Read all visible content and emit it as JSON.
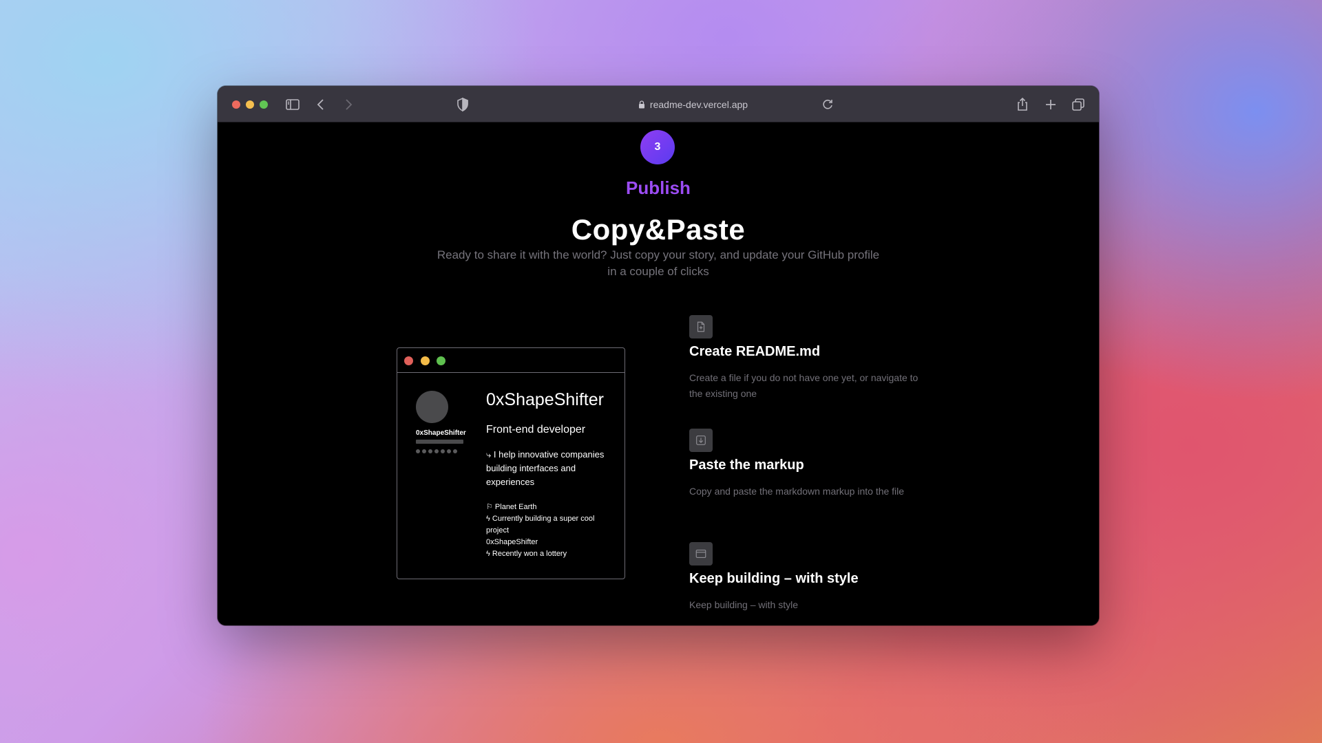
{
  "browser": {
    "url": "readme-dev.vercel.app"
  },
  "hero": {
    "step_number": "3",
    "step_label": "Publish",
    "title": "Copy&Paste",
    "subtitle": "Ready to share it with the world? Just copy your story, and update your GitHub profile in a couple of clicks"
  },
  "mock_profile": {
    "username": "0xShapeShifter",
    "name": "0xShapeShifter",
    "role": "Front-end developer",
    "bio": "⤷ I help innovative companies building interfaces and experiences",
    "facts": [
      "⚐ Planet Earth",
      "ϟ Currently building a super cool project",
      "0xShapeShifter",
      "ϟ Recently won a lottery"
    ]
  },
  "steps": [
    {
      "icon": "file-plus-icon",
      "title": "Create README.md",
      "description": "Create a file if you do not have one yet, or navigate to the existing one"
    },
    {
      "icon": "download-icon",
      "title": "Paste the markup",
      "description": "Copy and paste the markdown markup into the file"
    },
    {
      "icon": "window-icon",
      "title": "Keep building – with style",
      "description": "Keep building – with style"
    }
  ]
}
